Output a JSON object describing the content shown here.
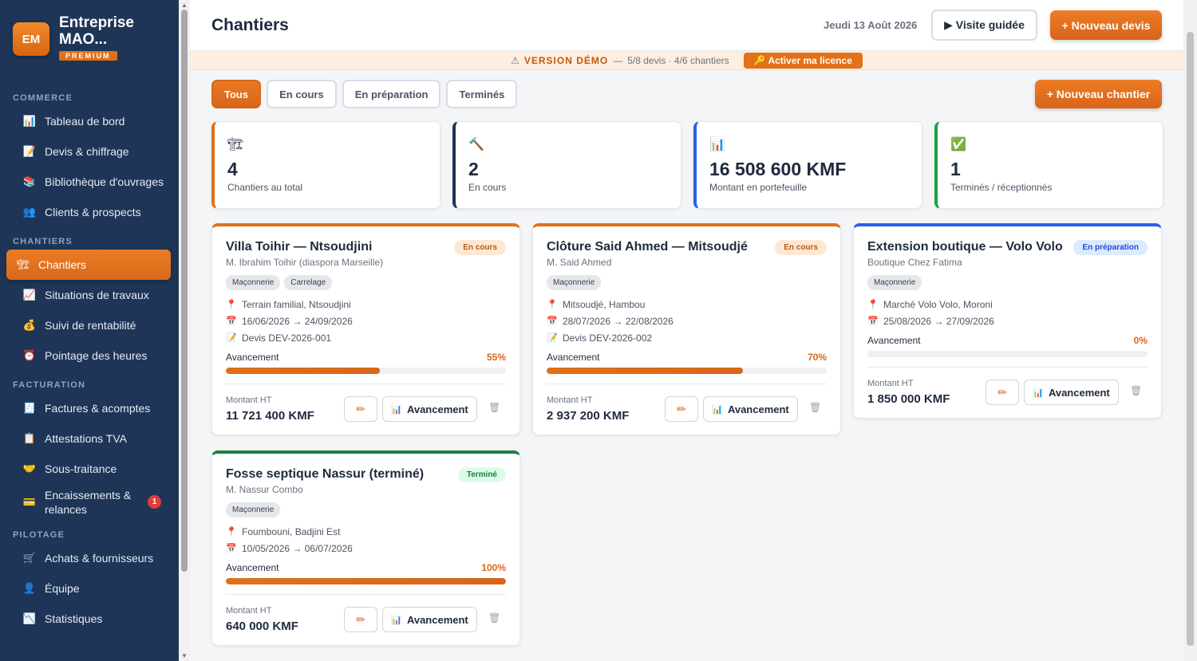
{
  "brand": {
    "logo": "EM",
    "name": "Entreprise MAO...",
    "badge": "PREMIUM"
  },
  "sidebar": {
    "sections": [
      {
        "title": "COMMERCE",
        "items": [
          {
            "icon": "📊",
            "label": "Tableau de bord"
          },
          {
            "icon": "📝",
            "label": "Devis & chiffrage"
          },
          {
            "icon": "📚",
            "label": "Bibliothèque d'ouvrages"
          },
          {
            "icon": "👥",
            "label": "Clients & prospects"
          }
        ]
      },
      {
        "title": "CHANTIERS",
        "items": [
          {
            "icon": "🏗",
            "label": "Chantiers",
            "active": true
          },
          {
            "icon": "📈",
            "label": "Situations de travaux"
          },
          {
            "icon": "💰",
            "label": "Suivi de rentabilité"
          },
          {
            "icon": "⏰",
            "label": "Pointage des heures"
          }
        ]
      },
      {
        "title": "FACTURATION",
        "items": [
          {
            "icon": "🧾",
            "label": "Factures & acomptes"
          },
          {
            "icon": "📋",
            "label": "Attestations TVA"
          },
          {
            "icon": "🤝",
            "label": "Sous-traitance"
          },
          {
            "icon": "💳",
            "label": "Encaissements & relances",
            "badge": "1"
          }
        ]
      },
      {
        "title": "PILOTAGE",
        "items": [
          {
            "icon": "🛒",
            "label": "Achats & fournisseurs"
          },
          {
            "icon": "👤",
            "label": "Équipe"
          },
          {
            "icon": "📉",
            "label": "Statistiques"
          }
        ]
      }
    ]
  },
  "header": {
    "title": "Chantiers",
    "date": "Jeudi 13 Août 2026",
    "tour_label": "▶ Visite guidée",
    "new_devis_label": "+ Nouveau devis"
  },
  "demo": {
    "icon": "⚠",
    "label": "VERSION DÉMO",
    "sep": "—",
    "quota": "5/8 devis · 4/6 chantiers",
    "license_label": "🔑 Activer ma licence"
  },
  "filters": [
    "Tous",
    "En cours",
    "En préparation",
    "Terminés"
  ],
  "new_chantier_label": "+ Nouveau chantier",
  "stats": [
    {
      "icon": "🏗",
      "value": "4",
      "label": "Chantiers au total",
      "color": "#e07018"
    },
    {
      "icon": "🔨",
      "value": "2",
      "label": "En cours",
      "color": "#1e3557"
    },
    {
      "icon": "📊",
      "value": "16 508 600 KMF",
      "label": "Montant en portefeuille",
      "color": "#2563eb"
    },
    {
      "icon": "✅",
      "value": "1",
      "label": "Terminés / réceptionnés",
      "color": "#16a34a"
    }
  ],
  "cards": [
    {
      "title": "Villa Toihir — Ntsoudjini",
      "client": "M. Ibrahim Toihir (diaspora Marseille)",
      "status": "En cours",
      "status_bg": "#fde8d4",
      "status_color": "#c05a12",
      "border": "#e07018",
      "tags": [
        "Maçonnerie",
        "Carrelage"
      ],
      "infos": [
        {
          "icon": "📍",
          "text": "Terrain familial, Ntsoudjini"
        },
        {
          "icon": "📅",
          "text": "16/06/2026 → 24/09/2026"
        },
        {
          "icon": "📝",
          "text": "Devis DEV-2026-001"
        }
      ],
      "progress_label": "Avancement",
      "progress": 55,
      "progress_text": "55%",
      "amount_label": "Montant HT",
      "amount": "11 721 400 KMF",
      "edit_icon": "✏",
      "avancement_label": "Avancement"
    },
    {
      "title": "Clôture Said Ahmed — Mitsoudjé",
      "client": "M. Said Ahmed",
      "status": "En cours",
      "status_bg": "#fde8d4",
      "status_color": "#c05a12",
      "border": "#e07018",
      "tags": [
        "Maçonnerie"
      ],
      "infos": [
        {
          "icon": "📍",
          "text": "Mitsoudjé, Hambou"
        },
        {
          "icon": "📅",
          "text": "28/07/2026 → 22/08/2026"
        },
        {
          "icon": "📝",
          "text": "Devis DEV-2026-002"
        }
      ],
      "progress_label": "Avancement",
      "progress": 70,
      "progress_text": "70%",
      "amount_label": "Montant HT",
      "amount": "2 937 200 KMF",
      "edit_icon": "✏",
      "avancement_label": "Avancement"
    },
    {
      "title": "Extension boutique — Volo Volo",
      "client": "Boutique Chez Fatima",
      "status": "En préparation",
      "status_bg": "#dbeafe",
      "status_color": "#1d4ed8",
      "border": "#2563eb",
      "tags": [
        "Maçonnerie"
      ],
      "infos": [
        {
          "icon": "📍",
          "text": "Marché Volo Volo, Moroni"
        },
        {
          "icon": "📅",
          "text": "25/08/2026 → 27/09/2026"
        }
      ],
      "progress_label": "Avancement",
      "progress": 0,
      "progress_text": "0%",
      "amount_label": "Montant HT",
      "amount": "1 850 000 KMF",
      "edit_icon": "✏",
      "avancement_label": "Avancement"
    },
    {
      "title": "Fosse septique Nassur (terminé)",
      "client": "M. Nassur Combo",
      "status": "Terminé",
      "status_bg": "#dcfce7",
      "status_color": "#15803d",
      "border": "#16833f",
      "tags": [
        "Maçonnerie"
      ],
      "infos": [
        {
          "icon": "📍",
          "text": "Foumbouni, Badjini Est"
        },
        {
          "icon": "📅",
          "text": "10/05/2026 → 06/07/2026"
        }
      ],
      "progress_label": "Avancement",
      "progress": 100,
      "progress_text": "100%",
      "amount_label": "Montant HT",
      "amount": "640 000 KMF",
      "edit_icon": "✏",
      "avancement_label": "Avancement"
    }
  ],
  "trash_icon": "🗑",
  "chart_icon": "📊"
}
